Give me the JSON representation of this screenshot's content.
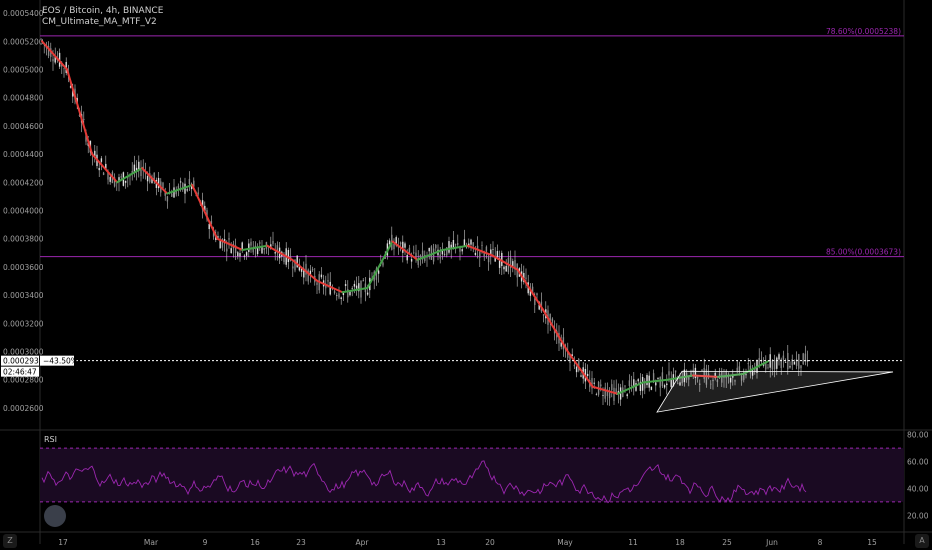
{
  "title": "EOS / Bitcoin, 4h, BINANCE",
  "indicator_name": "CM_Ultimate_MA_MTF_V2",
  "rsi_label": "RSI",
  "price_axis_labels": [
    "0.0005400",
    "0.0005200",
    "0.0005000",
    "0.0004800",
    "0.0004600",
    "0.0004400",
    "0.0004200",
    "0.0004000",
    "0.0003800",
    "0.0003600",
    "0.0003400",
    "0.0003200",
    "0.0003000",
    "0.0002800",
    "0.0002600"
  ],
  "rsi_axis_labels": [
    "80.00",
    "60.00",
    "40.00",
    "20.00"
  ],
  "date_labels": [
    "17",
    "Mar",
    "9",
    "16",
    "23",
    "Apr",
    "13",
    "20",
    "May",
    "11",
    "18",
    "25",
    "Jun",
    "8",
    "15"
  ],
  "fib_levels": [
    {
      "label": "78.60%(0.0005238)",
      "price": 0.0005238
    },
    {
      "label": "85.00%(0.0003673)",
      "price": 0.0003673
    }
  ],
  "current_price": {
    "value": "0.0002935",
    "price": 0.0002935
  },
  "countdown": "02:46:47",
  "change_label": "−43.50%",
  "corner_left": "Z",
  "corner_right": "A",
  "colors": {
    "fib": "#9c27b0",
    "ma_down": "#e53935",
    "ma_up": "#43a047",
    "candle": "#c8c8c8",
    "rsi": "#9c27b0",
    "rsi_fill": "#1a0a22",
    "triangle": "#ffffff"
  },
  "chart_data": {
    "type": "line",
    "title": "EOS / Bitcoin, 4h, BINANCE",
    "price_range": [
      0.00025,
      0.000545
    ],
    "rsi_range": [
      12,
      82
    ],
    "rsi_bands": [
      70,
      30
    ],
    "price_path": [
      {
        "x": "Feb 16",
        "y": 0.00052
      },
      {
        "x": "Feb 18",
        "y": 0.0005
      },
      {
        "x": "Feb 20",
        "y": 0.00044
      },
      {
        "x": "Feb 22",
        "y": 0.00042
      },
      {
        "x": "Feb 25",
        "y": 0.00043
      },
      {
        "x": "Mar 1",
        "y": 0.000412
      },
      {
        "x": "Mar 5",
        "y": 0.000418
      },
      {
        "x": "Mar 9",
        "y": 0.00038
      },
      {
        "x": "Mar 13",
        "y": 0.000372
      },
      {
        "x": "Mar 16",
        "y": 0.000375
      },
      {
        "x": "Mar 20",
        "y": 0.000365
      },
      {
        "x": "Mar 23",
        "y": 0.00035
      },
      {
        "x": "Mar 27",
        "y": 0.000342
      },
      {
        "x": "Apr 1",
        "y": 0.000345
      },
      {
        "x": "Apr 6",
        "y": 0.000378
      },
      {
        "x": "Apr 10",
        "y": 0.000365
      },
      {
        "x": "Apr 13",
        "y": 0.000372
      },
      {
        "x": "Apr 17",
        "y": 0.000375
      },
      {
        "x": "Apr 20",
        "y": 0.000368
      },
      {
        "x": "Apr 25",
        "y": 0.000358
      },
      {
        "x": "Apr 30",
        "y": 0.00033
      },
      {
        "x": "May 4",
        "y": 0.0003
      },
      {
        "x": "May 8",
        "y": 0.000275
      },
      {
        "x": "May 11",
        "y": 0.00027
      },
      {
        "x": "May 15",
        "y": 0.000278
      },
      {
        "x": "May 20",
        "y": 0.00028
      },
      {
        "x": "May 25",
        "y": 0.000283
      },
      {
        "x": "May 30",
        "y": 0.000282
      },
      {
        "x": "Jun 2",
        "y": 0.000284
      },
      {
        "x": "Jun 5",
        "y": 0.000293
      }
    ]
  }
}
